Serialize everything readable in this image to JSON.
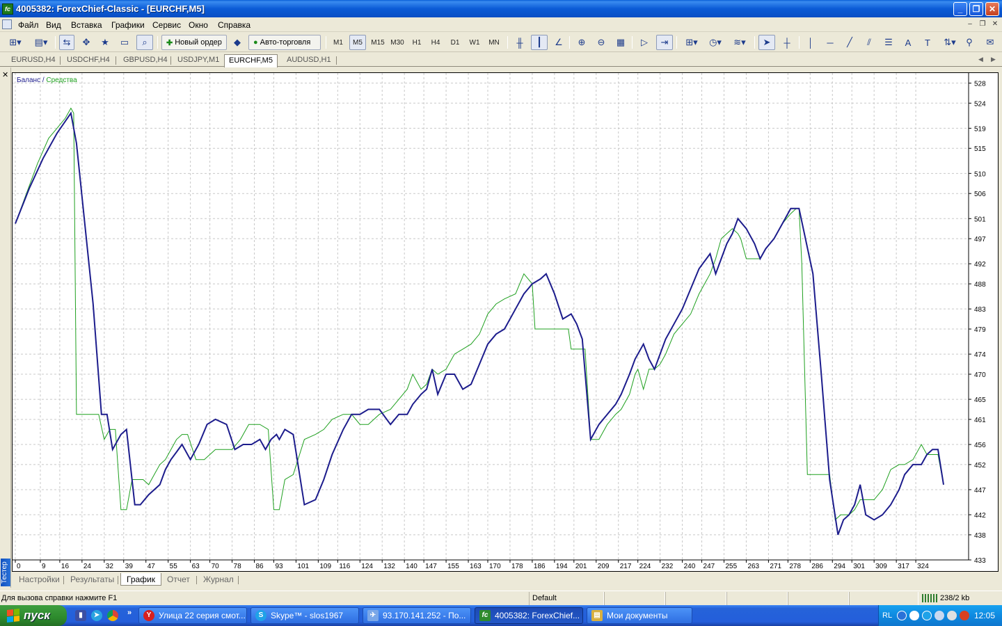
{
  "window": {
    "title": "4005382: ForexChief-Classic - [EURCHF,M5]",
    "app_icon": "fc"
  },
  "menu": {
    "items": [
      "Файл",
      "Вид",
      "Вставка",
      "Графики",
      "Сервис",
      "Окно",
      "Справка"
    ]
  },
  "toolbar": {
    "new_order_label": "Новый ордер",
    "auto_trading_label": "Авто-торговля",
    "timeframes": [
      "M1",
      "M5",
      "M15",
      "M30",
      "H1",
      "H4",
      "D1",
      "W1",
      "MN"
    ],
    "active_timeframe": "M5"
  },
  "symbol_tabs": {
    "tabs": [
      "EURUSD,H4",
      "USDCHF,H4",
      "GBPUSD,H4",
      "USDJPY,M1",
      "EURCHF,M5",
      "AUDUSD,H1"
    ],
    "active": "EURCHF,M5"
  },
  "tester": {
    "side_title": "Тестер",
    "bottom_tabs": [
      "Настройки",
      "Результаты",
      "График",
      "Отчет",
      "Журнал"
    ],
    "active_tab": "График"
  },
  "chart_data": {
    "type": "line",
    "legend": {
      "balance": "Баланс",
      "separator": " / ",
      "equity": "Средства",
      "placement": "top-left"
    },
    "ylim": [
      433,
      530
    ],
    "y_ticks": [
      528,
      524,
      519,
      515,
      510,
      506,
      501,
      497,
      492,
      488,
      483,
      479,
      474,
      470,
      465,
      461,
      456,
      452,
      447,
      442,
      438,
      433
    ],
    "xlim": [
      0,
      340
    ],
    "x_ticks": [
      0,
      9,
      16,
      24,
      32,
      39,
      47,
      55,
      63,
      70,
      78,
      86,
      93,
      101,
      109,
      116,
      124,
      132,
      140,
      147,
      155,
      163,
      170,
      178,
      186,
      194,
      201,
      209,
      217,
      224,
      232,
      240,
      247,
      255,
      263,
      271,
      278,
      286,
      294,
      301,
      309,
      317,
      324
    ],
    "grid": true,
    "series": [
      {
        "name": "Баланс",
        "color": "#1C1C8C",
        "x": [
          0,
          5,
          10,
          15,
          20,
          22,
          28,
          31,
          33,
          35,
          38,
          40,
          43,
          45,
          48,
          52,
          54,
          56,
          60,
          63,
          66,
          69,
          72,
          76,
          79,
          82,
          85,
          88,
          90,
          92,
          94,
          95,
          97,
          100,
          104,
          108,
          111,
          114,
          118,
          121,
          124,
          127,
          131,
          135,
          138,
          141,
          143,
          146,
          148,
          150,
          152,
          155,
          158,
          161,
          164,
          167,
          170,
          173,
          176,
          180,
          183,
          186,
          189,
          191,
          194,
          197,
          200,
          202,
          204,
          207,
          210,
          213,
          216,
          218,
          221,
          223,
          226,
          228,
          230,
          232,
          234,
          237,
          240,
          243,
          246,
          250,
          252,
          254,
          256,
          258,
          260,
          263,
          266,
          268,
          270,
          273,
          276,
          279,
          282,
          287,
          290,
          293,
          296,
          298,
          300,
          302,
          304,
          306,
          309,
          312,
          315,
          318,
          320,
          323,
          326,
          328,
          330,
          332,
          334
        ],
        "y": [
          500,
          507,
          513,
          518,
          522,
          516,
          484,
          462,
          462,
          455,
          458,
          459,
          444,
          444,
          446,
          448,
          451,
          453,
          456,
          453,
          456,
          460,
          461,
          460,
          455,
          456,
          456,
          457,
          455,
          457,
          458,
          457,
          459,
          458,
          444,
          445,
          449,
          454,
          459,
          462,
          462,
          463,
          463,
          460,
          462,
          462,
          464,
          466,
          467,
          471,
          466,
          470,
          470,
          467,
          468,
          472,
          476,
          478,
          479,
          483,
          486,
          488,
          489,
          490,
          486,
          481,
          482,
          480,
          477,
          457,
          460,
          462,
          464,
          466,
          470,
          473,
          476,
          473,
          471,
          474,
          477,
          480,
          483,
          487,
          491,
          494,
          490,
          493,
          496,
          498,
          501,
          499,
          496,
          493,
          495,
          497,
          500,
          503,
          503,
          490,
          470,
          449,
          438,
          441,
          442,
          444,
          448,
          442,
          441,
          442,
          444,
          447,
          450,
          452,
          452,
          454,
          455,
          455,
          448
        ]
      },
      {
        "name": "Средства",
        "color": "#1FA01F",
        "x": [
          0,
          4,
          8,
          12,
          15,
          18,
          20,
          21,
          22,
          26,
          30,
          32,
          34,
          36,
          38,
          40,
          42,
          44,
          46,
          48,
          50,
          52,
          54,
          56,
          58,
          60,
          62,
          65,
          68,
          72,
          75,
          78,
          81,
          84,
          88,
          91,
          93,
          95,
          97,
          100,
          104,
          108,
          111,
          114,
          118,
          121,
          124,
          127,
          131,
          135,
          138,
          141,
          143,
          146,
          148,
          150,
          152,
          155,
          158,
          161,
          164,
          167,
          170,
          173,
          176,
          180,
          183,
          186,
          187,
          190,
          195,
          199,
          200,
          202,
          204,
          205,
          207,
          210,
          213,
          216,
          218,
          221,
          223,
          224,
          226,
          228,
          230,
          232,
          234,
          237,
          240,
          243,
          246,
          250,
          252,
          254,
          256,
          258,
          260,
          261,
          263,
          266,
          268,
          270,
          273,
          276,
          279,
          281,
          282,
          283,
          285,
          290,
          293,
          295,
          297,
          300,
          302,
          304,
          306,
          309,
          312,
          315,
          318,
          320,
          323,
          326,
          328,
          330,
          332,
          334
        ],
        "y": [
          500,
          506,
          512,
          517,
          519,
          521,
          523,
          522,
          462,
          462,
          462,
          457,
          459,
          459,
          443,
          443,
          449,
          449,
          449,
          448,
          450,
          452,
          453,
          455,
          457,
          458,
          458,
          453,
          453,
          455,
          455,
          455,
          457,
          460,
          460,
          459,
          443,
          443,
          449,
          450,
          457,
          458,
          459,
          461,
          462,
          462,
          460,
          460,
          462,
          463,
          465,
          467,
          470,
          467,
          468,
          471,
          470,
          471,
          474,
          475,
          476,
          478,
          482,
          484,
          485,
          486,
          490,
          488,
          479,
          479,
          479,
          479,
          475,
          475,
          475,
          475,
          457,
          457,
          460,
          462,
          463,
          466,
          470,
          471,
          467,
          471,
          471,
          472,
          474,
          478,
          480,
          482,
          486,
          490,
          493,
          497,
          498,
          499,
          498,
          497,
          493,
          493,
          493,
          495,
          497,
          500,
          502,
          503,
          503,
          492,
          450,
          450,
          450,
          441,
          442,
          442,
          443,
          445,
          445,
          445,
          447,
          451,
          452,
          452,
          453,
          456,
          454,
          454,
          454,
          448
        ]
      }
    ]
  },
  "status": {
    "help_text": "Для вызова справки нажмите F1",
    "profile": "Default",
    "traffic": "238/2 kb"
  },
  "taskbar": {
    "start_label": "пуск",
    "tasks": [
      {
        "label": "Улица 22 серия смот...",
        "icon": "Y",
        "color": "#D82020"
      },
      {
        "label": "Skype™ - slos1967",
        "icon": "S",
        "color": "#1FA2E8"
      },
      {
        "label": "93.170.141.252 - По...",
        "icon": "✈",
        "color": "#7AA7E8"
      },
      {
        "label": "4005382: ForexChief...",
        "icon": "fc",
        "color": "#2E8A2E"
      },
      {
        "label": "Мои документы",
        "icon": "▤",
        "color": "#D8B040"
      }
    ],
    "active_task": 3,
    "lang": "RL",
    "clock": "12:05"
  }
}
